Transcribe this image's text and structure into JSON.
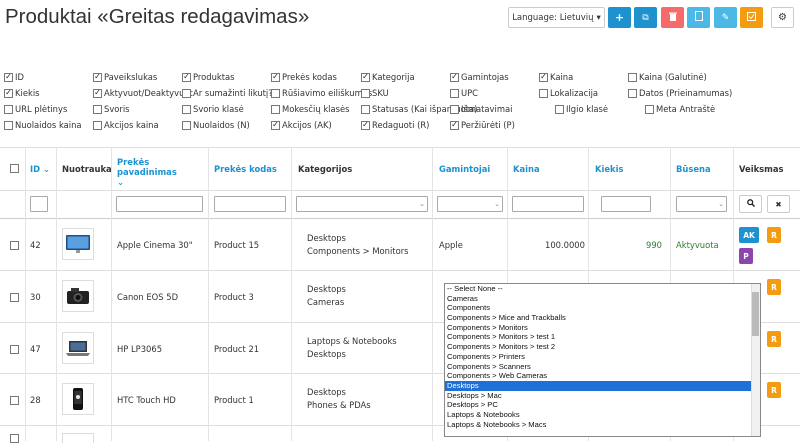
{
  "title": "Produktai «Greitas redagavimas»",
  "language": {
    "label": "Language: Lietuvių",
    "caret": "▾"
  },
  "toolbar": {
    "add": "+",
    "copy": "⧉",
    "delete": "🗑",
    "doc": "▢",
    "edit": "✎",
    "check": "✔",
    "settings": "⚙"
  },
  "columns_toggle": [
    {
      "label": "ID",
      "checked": true
    },
    {
      "label": "Paveikslukas",
      "checked": true
    },
    {
      "label": "Produktas",
      "checked": true
    },
    {
      "label": "Prekės kodas",
      "checked": true
    },
    {
      "label": "Kategorija",
      "checked": true
    },
    {
      "label": "Gamintojas",
      "checked": true
    },
    {
      "label": "Kaina",
      "checked": true
    },
    {
      "label": "Kaina (Galutinė)",
      "checked": false
    },
    {
      "label": "Kiekis",
      "checked": true
    },
    {
      "label": "Aktyvuot/Deaktyvuot",
      "checked": true
    },
    {
      "label": "Ar sumažinti likutį?",
      "checked": false
    },
    {
      "label": "Rūšiavimo eiliškumas",
      "checked": false
    },
    {
      "label": "SKU",
      "checked": false
    },
    {
      "label": "UPC",
      "checked": false
    },
    {
      "label": "Lokalizacija",
      "checked": false
    },
    {
      "label": "Datos (Prieinamumas)",
      "checked": false
    },
    {
      "label": "URL plėtinys",
      "checked": false
    },
    {
      "label": "Svoris",
      "checked": false
    },
    {
      "label": "Svorio klasė",
      "checked": false
    },
    {
      "label": "Mokesčių klasės",
      "checked": false
    },
    {
      "label": "Statusas (Kai išparduota)",
      "checked": false
    },
    {
      "label": "Išmatavimai",
      "checked": false
    },
    {
      "label": "Ilgio klasė",
      "checked": false
    },
    {
      "label": "Meta Antraštė",
      "checked": false
    },
    {
      "label": "Nuolaidos kaina",
      "checked": false
    },
    {
      "label": "Akcijos kaina",
      "checked": false
    },
    {
      "label": "Nuolaidos (N)",
      "checked": false
    },
    {
      "label": "Akcijos (AK)",
      "checked": true
    },
    {
      "label": "Redaguoti (R)",
      "checked": true
    },
    {
      "label": "Peržiūrėti (P)",
      "checked": true
    }
  ],
  "headers": {
    "id": "ID",
    "thumb": "Nuotrauka",
    "name": "Prekės pavadinimas",
    "model": "Prekės kodas",
    "category": "Kategorijos",
    "manufacturer": "Gamintojai",
    "price": "Kaina",
    "qty": "Kiekis",
    "status": "Būsena",
    "actions": "Veiksmas"
  },
  "filters": {
    "search": "🔍",
    "clear": "✖",
    "caret": "⌄"
  },
  "rows": [
    {
      "id": "42",
      "name": "Apple Cinema 30\"",
      "model": "Product 15",
      "cat1": "Desktops",
      "cat2": "Components  >  Monitors",
      "manufacturer": "Apple",
      "price": "100.0000",
      "qty": "990",
      "status": "Aktyvuota"
    },
    {
      "id": "30",
      "name": "Canon EOS 5D",
      "model": "Product 3",
      "cat1": "Desktops",
      "cat2": "Cameras"
    },
    {
      "id": "47",
      "name": "HP LP3065",
      "model": "Product 21",
      "cat1": "Laptops & Notebooks",
      "cat2": "Desktops"
    },
    {
      "id": "28",
      "name": "HTC Touch HD",
      "model": "Product 1",
      "cat1": "Desktops",
      "cat2": "Phones & PDAs"
    }
  ],
  "actions": {
    "ak": "AK",
    "r": "R",
    "p": "P"
  },
  "category_options": [
    "-- Select None --",
    "Cameras",
    "Components",
    "Components  >  Mice and Trackballs",
    "Components  >  Monitors",
    "Components  >  Monitors  >  test 1",
    "Components  >  Monitors  >  test 2",
    "Components  >  Printers",
    "Components  >  Scanners",
    "Components  >  Web Cameras",
    "Desktops",
    "Desktops  >  Mac",
    "Desktops  >  PC",
    "Laptops & Notebooks",
    "Laptops & Notebooks  >  Macs"
  ],
  "selected_option": "Desktops",
  "colors": {
    "blue": "#1e91cf",
    "red": "#f56b6b",
    "cyan": "#4cb8e5",
    "orange": "#f39c12",
    "purple": "#8e44ad",
    "green": "#2e7d32",
    "selected": "#1e6fd6"
  }
}
